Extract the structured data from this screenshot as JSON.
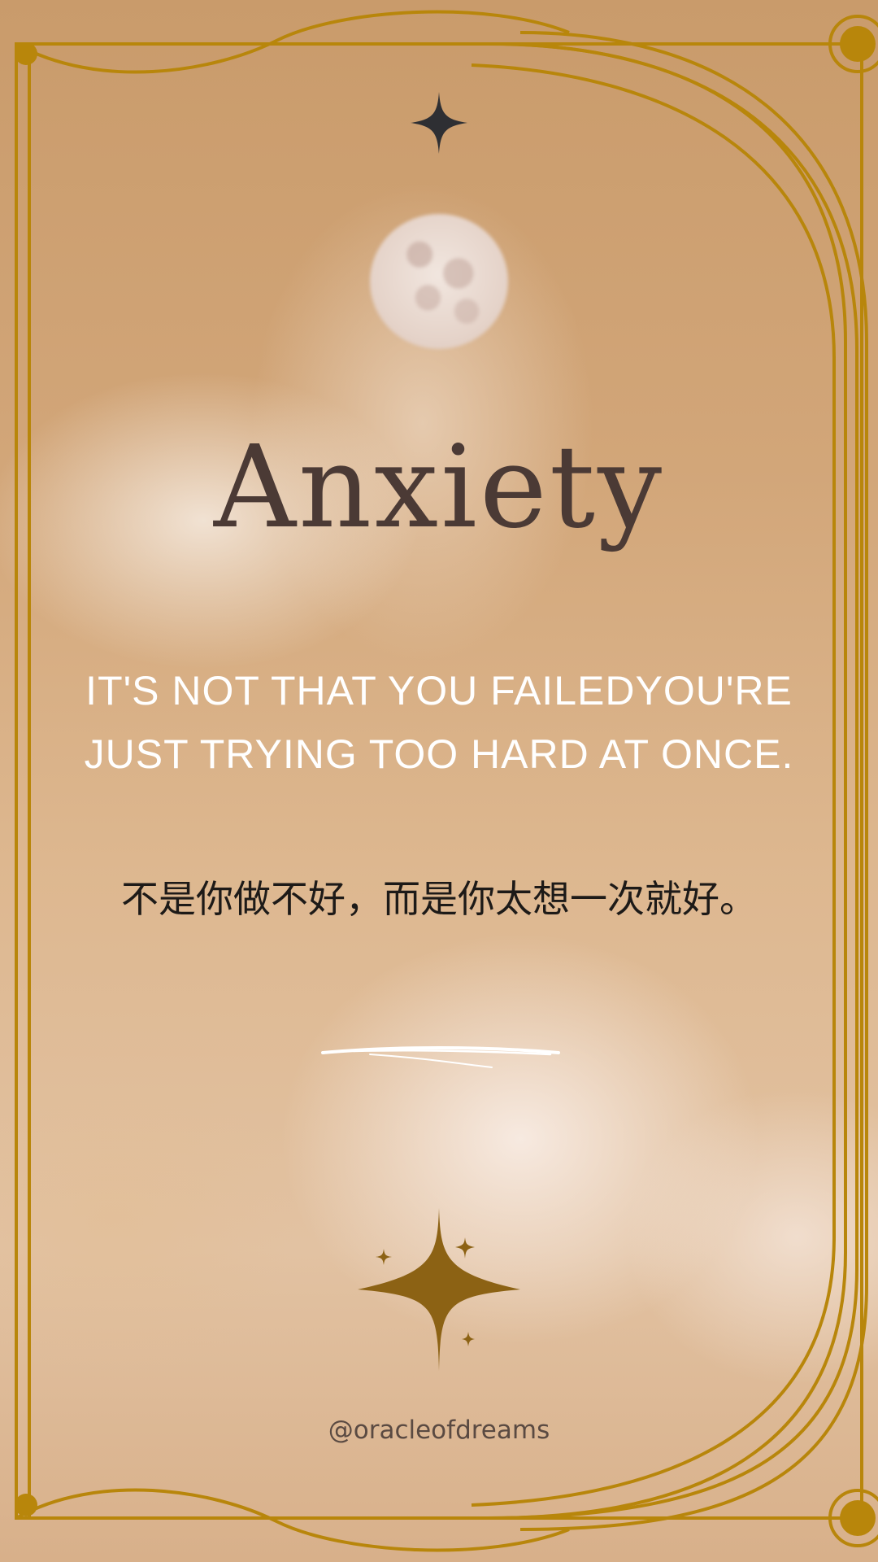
{
  "title": "Anxiety",
  "quote_en": "IT'S NOT THAT YOU FAILEDYOU'RE JUST TRYING TOO HARD AT ONCE.",
  "quote_zh": "不是你做不好，而是你太想一次就好。",
  "handle": "@oracleofdreams",
  "colors": {
    "frame": "#b8860b",
    "title": "#4b3a35",
    "quote_en": "#ffffff",
    "quote_zh": "#1d1a18",
    "star_top": "#2e2f33",
    "star_bottom": "#8c6214"
  },
  "icons": [
    "four-point-star-icon",
    "moon-icon",
    "brush-stroke-divider",
    "sparkles-icon"
  ]
}
